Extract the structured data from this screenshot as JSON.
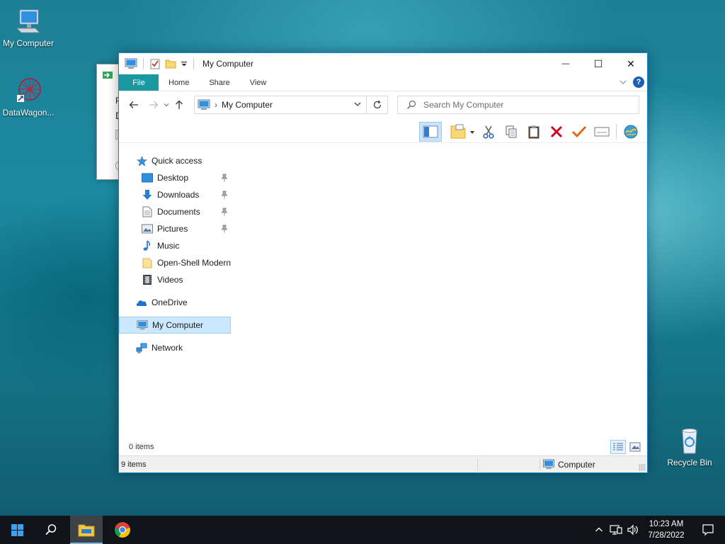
{
  "desktop": {
    "icons": [
      {
        "label": "My Computer"
      },
      {
        "label": "DataWagon..."
      },
      {
        "label": "Recycle Bin"
      }
    ]
  },
  "background_window": {
    "text1": "P",
    "text2": "D"
  },
  "window": {
    "title": "My Computer",
    "controls": {
      "minimize": "—",
      "maximize": "☐",
      "close": "✕"
    },
    "ribbon_tabs": [
      {
        "label": "File"
      },
      {
        "label": "Home"
      },
      {
        "label": "Share"
      },
      {
        "label": "View"
      }
    ],
    "address": {
      "breadcrumb_sep": "›",
      "location": "My Computer"
    },
    "search": {
      "placeholder": "Search My Computer"
    },
    "nav_pane": {
      "quick_access": "Quick access",
      "quick_items": [
        {
          "label": "Desktop"
        },
        {
          "label": "Downloads"
        },
        {
          "label": "Documents"
        },
        {
          "label": "Pictures"
        },
        {
          "label": "Music"
        },
        {
          "label": "Open-Shell Modern"
        },
        {
          "label": "Videos"
        }
      ],
      "onedrive": "OneDrive",
      "my_computer": "My Computer",
      "network": "Network"
    },
    "content": {
      "items_count": "0 items"
    },
    "statusbar": {
      "items": "9 items",
      "location": "Computer"
    }
  },
  "taskbar": {
    "clock_time": "10:23 AM",
    "clock_date": "7/28/2022"
  },
  "colors": {
    "accent": "#1883d7",
    "file_tab": "#1a9aa0",
    "selection": "#cce8ff",
    "taskbar": "#101418"
  }
}
